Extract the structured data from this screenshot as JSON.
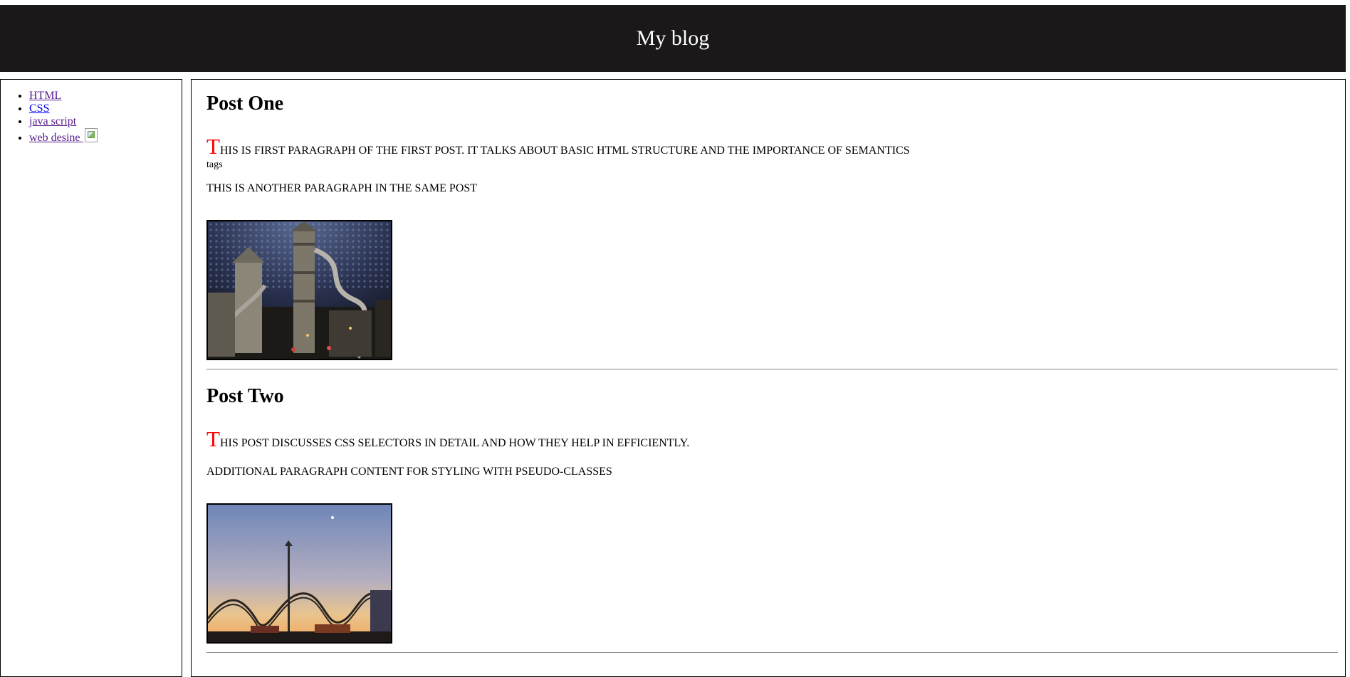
{
  "header": {
    "title": "My blog"
  },
  "sidebar": {
    "items": [
      {
        "label": "HTML"
      },
      {
        "label": "CSS"
      },
      {
        "label": "java script "
      },
      {
        "label": "web desine "
      }
    ]
  },
  "posts": [
    {
      "title": "Post One",
      "first_letter": "T",
      "first_paragraph_rest": "his is first paragraph of the first post. It talks about basic HTML structure and the importance of semantics",
      "tags": "tags",
      "second_paragraph": "This is another paragraph in the same post"
    },
    {
      "title": "Post Two",
      "first_letter": "T",
      "first_paragraph_rest": "his post discusses CSS selectors in detail and how they help in efficiently.",
      "second_paragraph": "Additional paragraph content for styling with pseudo-classes"
    }
  ],
  "colors": {
    "header_bg": "#1a1818",
    "dropcap": "#ff0000",
    "link_visited": "#551a8b"
  }
}
